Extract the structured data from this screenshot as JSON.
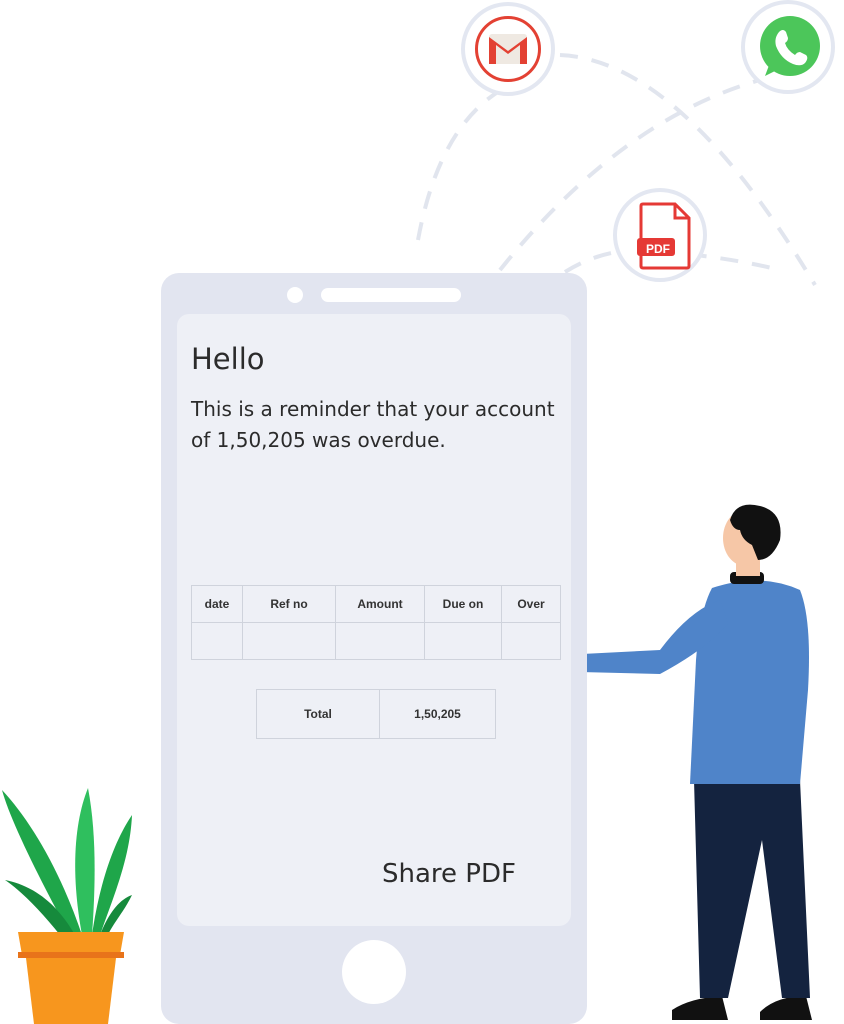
{
  "screen": {
    "greeting": "Hello",
    "message": "This is a reminder that your account of 1,50,205 was overdue."
  },
  "invoice_table": {
    "columns": [
      "date",
      "Ref no",
      "Amount",
      "Due on",
      "Over"
    ],
    "rows": [
      [
        "",
        "",
        "",
        "",
        ""
      ]
    ]
  },
  "total": {
    "label": "Total",
    "value": "1,50,205"
  },
  "share_button": {
    "label": "Share PDF"
  },
  "share_targets": {
    "gmail_icon": "gmail-icon",
    "whatsapp_icon": "whatsapp-icon",
    "pdf_icon": "pdf-icon",
    "pdf_badge": "PDF"
  },
  "colors": {
    "gmail_red": "#e34133",
    "whatsapp_green": "#4cc65a",
    "pdf_red": "#e53935",
    "shirt_blue": "#4f84c9",
    "pants_navy": "#14233f",
    "pot_orange": "#f7961e",
    "leaf_green": "#1fa64a"
  }
}
